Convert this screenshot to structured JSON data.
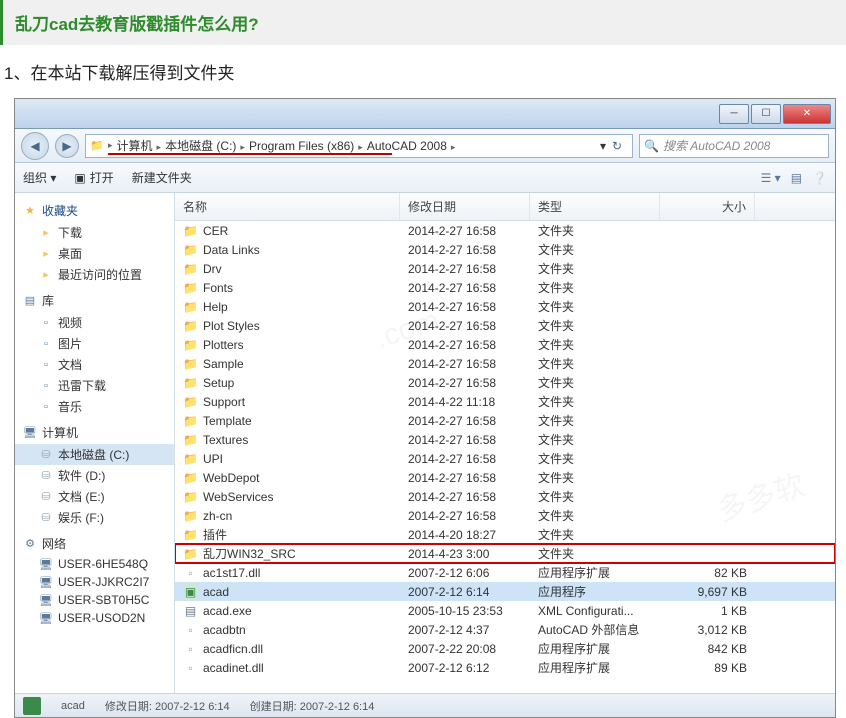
{
  "article": {
    "title": "乱刀cad去教育版戳插件怎么用?",
    "step1": "1、在本站下载解压得到文件夹"
  },
  "window": {
    "navBack": "◀",
    "navFwd": "▶",
    "breadcrumbs": [
      "计算机",
      "本地磁盘 (C:)",
      "Program Files (x86)",
      "AutoCAD 2008"
    ],
    "dropdown": "▾",
    "refresh": "↻",
    "searchPlaceholder": "搜索 AutoCAD 2008",
    "searchIcon": "🔍",
    "minLabel": "─",
    "maxLabel": "☐",
    "closeLabel": "✕"
  },
  "toolbar": {
    "organize": "组织 ▾",
    "open": "打开",
    "openIcon": "▣",
    "newFolder": "新建文件夹",
    "viewIcon": "☰ ▾",
    "prevIcon": "▤",
    "helpIcon": "❔"
  },
  "sidebar": {
    "favorites": {
      "label": "收藏夹",
      "items": [
        "下载",
        "桌面",
        "最近访问的位置"
      ]
    },
    "libraries": {
      "label": "库",
      "items": [
        "视频",
        "图片",
        "文档",
        "迅雷下载",
        "音乐"
      ]
    },
    "computer": {
      "label": "计算机",
      "items": [
        "本地磁盘 (C:)",
        "软件 (D:)",
        "文档 (E:)",
        "娱乐 (F:)"
      ]
    },
    "network": {
      "label": "网络",
      "items": [
        "USER-6HE548Q",
        "USER-JJKRC2I7",
        "USER-SBT0H5C",
        "USER-USOD2N"
      ]
    }
  },
  "fileList": {
    "headers": {
      "name": "名称",
      "date": "修改日期",
      "type": "类型",
      "size": "大小"
    },
    "rows": [
      {
        "icon": "folder",
        "name": "CER",
        "date": "2014-2-27 16:58",
        "type": "文件夹",
        "size": ""
      },
      {
        "icon": "folder",
        "name": "Data Links",
        "date": "2014-2-27 16:58",
        "type": "文件夹",
        "size": ""
      },
      {
        "icon": "folder",
        "name": "Drv",
        "date": "2014-2-27 16:58",
        "type": "文件夹",
        "size": ""
      },
      {
        "icon": "folder",
        "name": "Fonts",
        "date": "2014-2-27 16:58",
        "type": "文件夹",
        "size": ""
      },
      {
        "icon": "folder",
        "name": "Help",
        "date": "2014-2-27 16:58",
        "type": "文件夹",
        "size": ""
      },
      {
        "icon": "folder",
        "name": "Plot Styles",
        "date": "2014-2-27 16:58",
        "type": "文件夹",
        "size": ""
      },
      {
        "icon": "folder",
        "name": "Plotters",
        "date": "2014-2-27 16:58",
        "type": "文件夹",
        "size": ""
      },
      {
        "icon": "folder",
        "name": "Sample",
        "date": "2014-2-27 16:58",
        "type": "文件夹",
        "size": ""
      },
      {
        "icon": "folder",
        "name": "Setup",
        "date": "2014-2-27 16:58",
        "type": "文件夹",
        "size": ""
      },
      {
        "icon": "folder",
        "name": "Support",
        "date": "2014-4-22 11:18",
        "type": "文件夹",
        "size": ""
      },
      {
        "icon": "folder",
        "name": "Template",
        "date": "2014-2-27 16:58",
        "type": "文件夹",
        "size": ""
      },
      {
        "icon": "folder",
        "name": "Textures",
        "date": "2014-2-27 16:58",
        "type": "文件夹",
        "size": ""
      },
      {
        "icon": "folder",
        "name": "UPI",
        "date": "2014-2-27 16:58",
        "type": "文件夹",
        "size": ""
      },
      {
        "icon": "folder",
        "name": "WebDepot",
        "date": "2014-2-27 16:58",
        "type": "文件夹",
        "size": ""
      },
      {
        "icon": "folder",
        "name": "WebServices",
        "date": "2014-2-27 16:58",
        "type": "文件夹",
        "size": ""
      },
      {
        "icon": "folder",
        "name": "zh-cn",
        "date": "2014-2-27 16:58",
        "type": "文件夹",
        "size": ""
      },
      {
        "icon": "folder",
        "name": "插件",
        "date": "2014-4-20 18:27",
        "type": "文件夹",
        "size": ""
      },
      {
        "icon": "folder",
        "name": "乱刀WIN32_SRC",
        "date": "2014-4-23 3:00",
        "type": "文件夹",
        "size": "",
        "highlight": true
      },
      {
        "icon": "dll",
        "name": "ac1st17.dll",
        "date": "2007-2-12 6:06",
        "type": "应用程序扩展",
        "size": "82 KB"
      },
      {
        "icon": "exe",
        "name": "acad",
        "date": "2007-2-12 6:14",
        "type": "应用程序",
        "size": "9,697 KB",
        "selected": true
      },
      {
        "icon": "cfg",
        "name": "acad.exe",
        "date": "2005-10-15 23:53",
        "type": "XML Configurati...",
        "size": "1 KB"
      },
      {
        "icon": "dll",
        "name": "acadbtn",
        "date": "2007-2-12 4:37",
        "type": "AutoCAD 外部信息",
        "size": "3,012 KB"
      },
      {
        "icon": "dll",
        "name": "acadficn.dll",
        "date": "2007-2-22 20:08",
        "type": "应用程序扩展",
        "size": "842 KB"
      },
      {
        "icon": "dll",
        "name": "acadinet.dll",
        "date": "2007-2-12 6:12",
        "type": "应用程序扩展",
        "size": "89 KB"
      }
    ]
  },
  "statusbar": {
    "name": "acad",
    "modLabel": "修改日期:",
    "modDate": "2007-2-12 6:14",
    "createLabel": "创建日期:",
    "createDate": "2007-2-12 6:14"
  }
}
